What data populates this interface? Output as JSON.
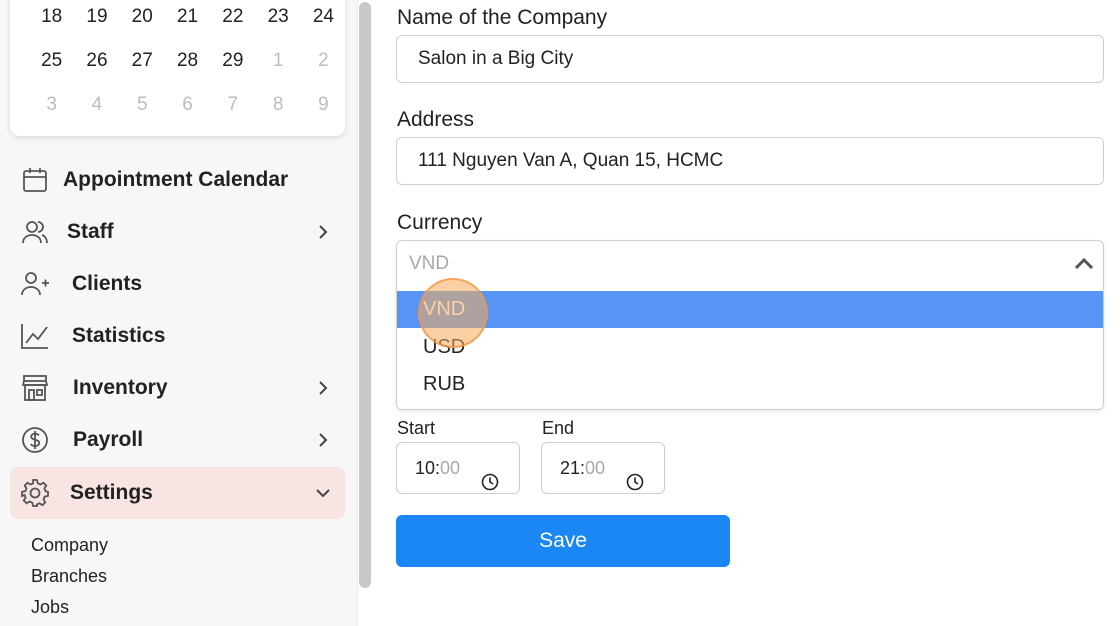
{
  "calendar": {
    "weeks": [
      [
        {
          "d": "18",
          "m": false
        },
        {
          "d": "19",
          "m": false
        },
        {
          "d": "20",
          "m": false
        },
        {
          "d": "21",
          "m": false
        },
        {
          "d": "22",
          "m": false
        },
        {
          "d": "23",
          "m": false
        },
        {
          "d": "24",
          "m": false
        }
      ],
      [
        {
          "d": "25",
          "m": false
        },
        {
          "d": "26",
          "m": false
        },
        {
          "d": "27",
          "m": false
        },
        {
          "d": "28",
          "m": false
        },
        {
          "d": "29",
          "m": false
        },
        {
          "d": "1",
          "m": true
        },
        {
          "d": "2",
          "m": true
        }
      ],
      [
        {
          "d": "3",
          "m": true
        },
        {
          "d": "4",
          "m": true
        },
        {
          "d": "5",
          "m": true
        },
        {
          "d": "6",
          "m": true
        },
        {
          "d": "7",
          "m": true
        },
        {
          "d": "8",
          "m": true
        },
        {
          "d": "9",
          "m": true
        }
      ]
    ]
  },
  "sidebar": {
    "items": [
      {
        "label": "Appointment Calendar",
        "icon": "calendar-icon",
        "has_chevron": false
      },
      {
        "label": "Staff",
        "icon": "staff-icon",
        "has_chevron": true
      },
      {
        "label": "Clients",
        "icon": "add-user-icon",
        "has_chevron": false
      },
      {
        "label": "Statistics",
        "icon": "chart-icon",
        "has_chevron": false
      },
      {
        "label": "Inventory",
        "icon": "store-icon",
        "has_chevron": true
      },
      {
        "label": "Payroll",
        "icon": "dollar-icon",
        "has_chevron": true
      },
      {
        "label": "Settings",
        "icon": "gear-icon",
        "has_chevron": true,
        "expanded": true
      }
    ],
    "submenu": [
      "Company",
      "Branches",
      "Jobs"
    ]
  },
  "form": {
    "company_label": "Name of the Company",
    "company_value": "Salon in a Big City",
    "address_label": "Address",
    "address_value": "111 Nguyen Van A, Quan 15, HCMC",
    "currency_label": "Currency",
    "currency_value": "VND",
    "currency_options": [
      "VND",
      "USD",
      "RUB"
    ],
    "start_label": "Start",
    "start_hours": "10",
    "start_minutes": "00",
    "end_label": "End",
    "end_hours": "21",
    "end_minutes": "00",
    "save_label": "Save"
  },
  "colors": {
    "active_nav_bg": "#f7e4e3",
    "selected_option_bg": "#5794f5",
    "primary_button": "#1a87f5",
    "cursor_highlight": "#f6ab5a"
  }
}
